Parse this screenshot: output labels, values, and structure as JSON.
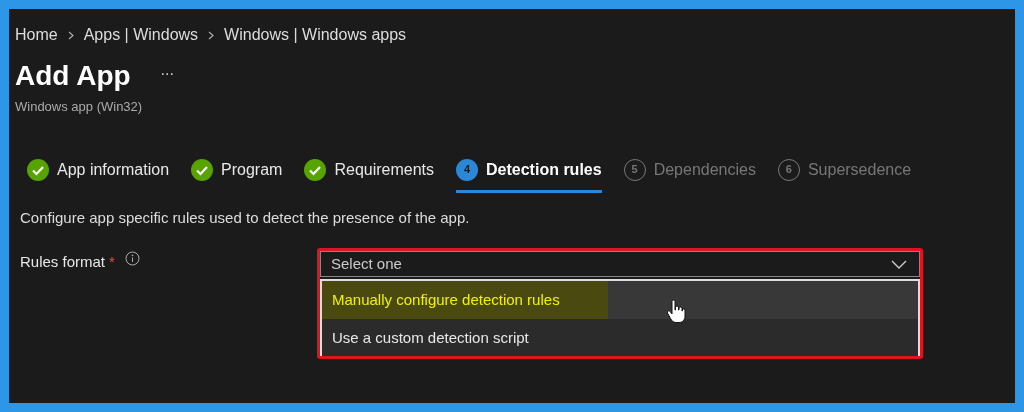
{
  "breadcrumb": [
    "Home",
    "Apps | Windows",
    "Windows | Windows apps"
  ],
  "title": "Add App",
  "more": "...",
  "subtitle": "Windows app (Win32)",
  "steps": [
    {
      "label": "App information",
      "kind": "complete",
      "selected": false
    },
    {
      "label": "Program",
      "kind": "complete",
      "selected": false
    },
    {
      "label": "Requirements",
      "kind": "complete",
      "selected": false
    },
    {
      "number": "4",
      "label": "Detection rules",
      "kind": "current",
      "selected": true
    },
    {
      "number": "5",
      "label": "Dependencies",
      "kind": "pending",
      "selected": false
    },
    {
      "number": "6",
      "label": "Supersedence",
      "kind": "pending",
      "selected": false
    }
  ],
  "description": "Configure app specific rules used to detect the presence of the app.",
  "field": {
    "label": "Rules format",
    "required_mark": "*",
    "placeholder": "Select one",
    "expanded": true,
    "highlighted": true,
    "options": [
      {
        "label": "Manually configure detection rules",
        "hovered": true,
        "highlighted": true
      },
      {
        "label": "Use a custom detection script",
        "hovered": false,
        "highlighted": false
      }
    ]
  }
}
